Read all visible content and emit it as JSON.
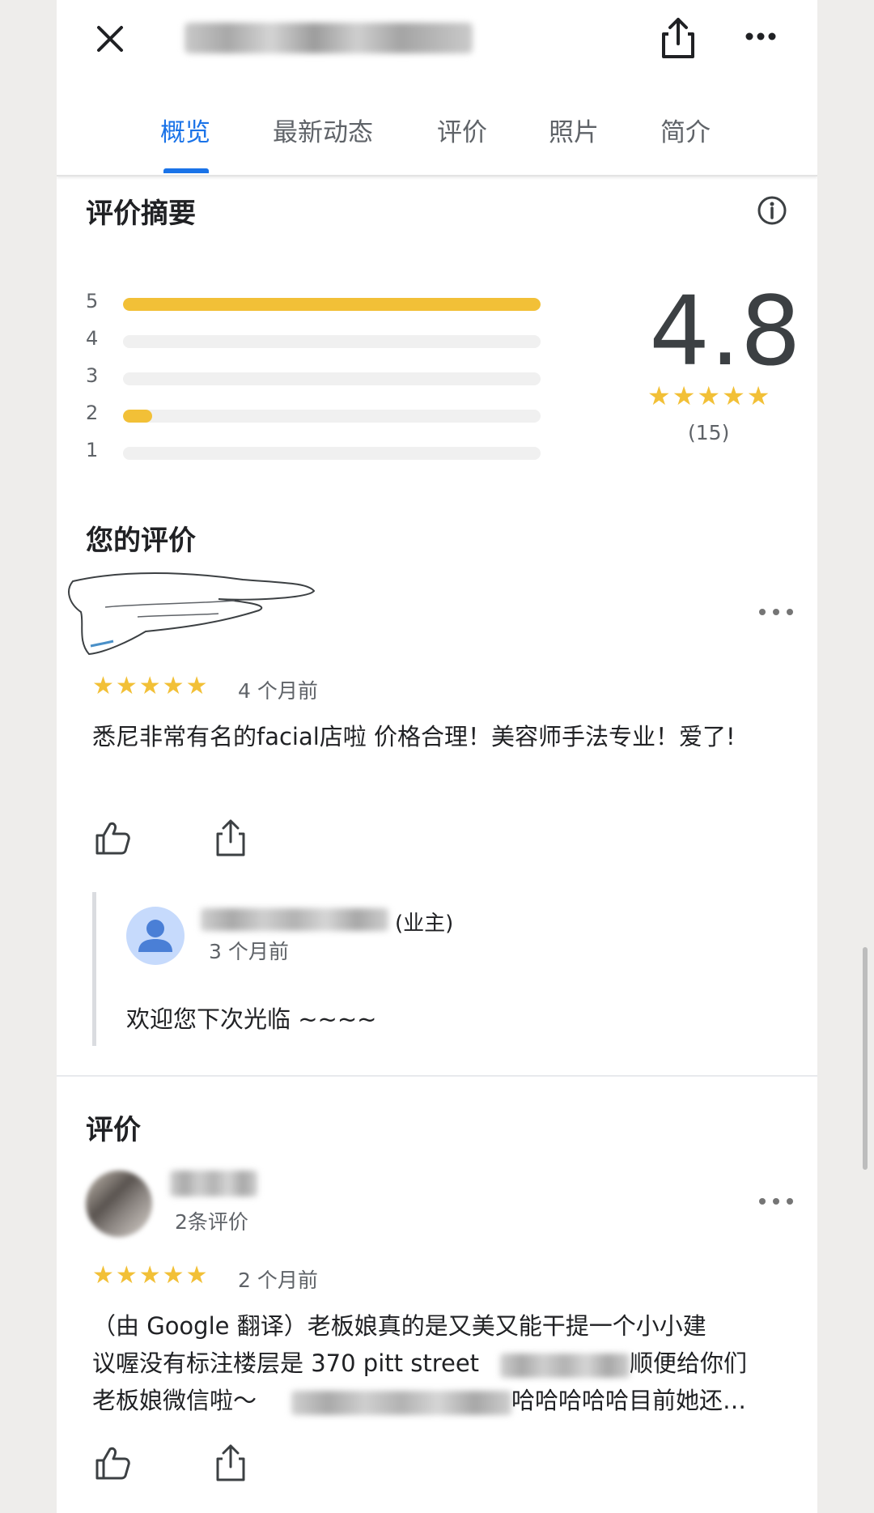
{
  "header": {
    "close_icon": "close-icon",
    "share_icon": "share-icon",
    "more_icon": "more-vert-icon"
  },
  "tabs": [
    {
      "label": "概览",
      "active": true
    },
    {
      "label": "最新动态",
      "active": false
    },
    {
      "label": "评价",
      "active": false
    },
    {
      "label": "照片",
      "active": false
    },
    {
      "label": "简介",
      "active": false
    }
  ],
  "summary": {
    "title": "评价摘要",
    "rating": "4.8",
    "stars": "★★★★★",
    "count": "(15)",
    "distribution": [
      {
        "star": "5",
        "fraction": 1.0
      },
      {
        "star": "4",
        "fraction": 0.0
      },
      {
        "star": "3",
        "fraction": 0.0
      },
      {
        "star": "2",
        "fraction": 0.07
      },
      {
        "star": "1",
        "fraction": 0.0
      }
    ]
  },
  "your_review": {
    "title": "您的评价",
    "stars": "★★★★★",
    "time": "4 个月前",
    "text": "悉尼非常有名的facial店啦 价格合理！美容师手法专业！爱了!",
    "reply": {
      "owner_tag": "(业主)",
      "time": "3 个月前",
      "text": "欢迎您下次光临 ~~~~"
    }
  },
  "reviews": {
    "title": "评价",
    "items": [
      {
        "review_count": "2条评价",
        "stars": "★★★★★",
        "time": "2 个月前",
        "line1": "（由 Google 翻译）老板娘真的是又美又能干提一个小小建",
        "line2a": "议喔没有标注楼层是 370 pitt street",
        "line2b": "顺便给你们",
        "line3a": "老板娘微信啦～",
        "line3b": "哈哈哈哈哈目前她还…"
      }
    ]
  },
  "colors": {
    "accent": "#1a73e8",
    "star": "#f2c037",
    "bar_track": "#f0f0f0"
  }
}
